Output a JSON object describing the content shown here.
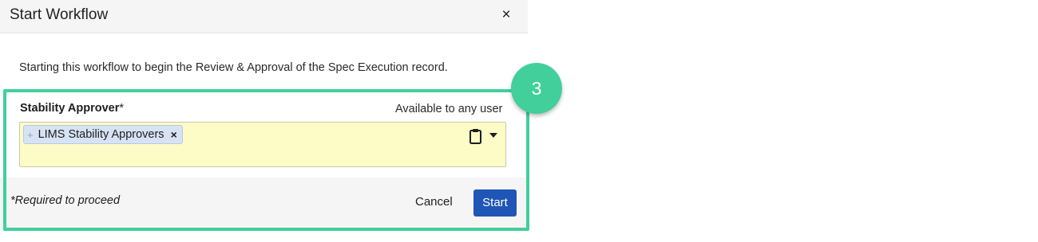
{
  "dialog": {
    "title": "Start Workflow",
    "close_label": "×",
    "description": "Starting this workflow to begin the Review & Approval of the Spec Execution record."
  },
  "field": {
    "label": "Stability Approver",
    "required_marker": "*",
    "availability": "Available to any user",
    "chip": {
      "plus_glyph": "+",
      "label": "LIMS Stability Approvers",
      "remove_glyph": "×"
    },
    "icons": [
      "clipboard-icon",
      "caret-down-icon"
    ],
    "background_color": "#fdfbc6"
  },
  "footer": {
    "required_note": "*Required to proceed",
    "cancel_label": "Cancel",
    "start_label": "Start"
  },
  "annotation": {
    "step_number": "3",
    "color": "#42cf9b"
  },
  "colors": {
    "primary_button": "#1f56b5",
    "chip_background": "#d7e3f4"
  }
}
